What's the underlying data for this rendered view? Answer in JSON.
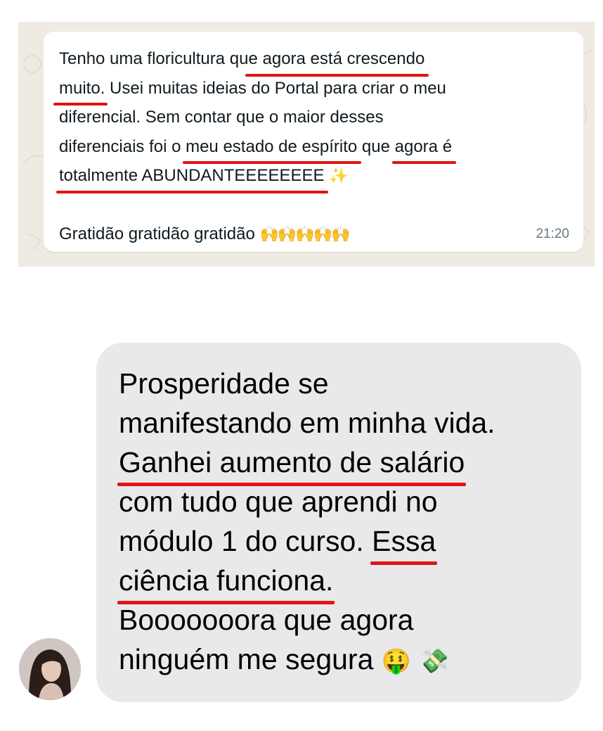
{
  "whatsapp_message": {
    "lines": [
      [
        "Tenho uma floricultura qu",
        "e agora está crescendo",
        ""
      ],
      [
        "",
        "muito.",
        " Usei muitas ideias do Portal para criar o meu"
      ],
      [
        "diferencial. Sem contar que o maior desses",
        "",
        ""
      ],
      [
        "diferenciais foi o ",
        "meu estado de espírito",
        " que "
      ],
      [
        "",
        "totalmente ABUNDANTEEEEEEEE",
        " "
      ]
    ],
    "line4_extra_underlined": "agora é",
    "line6": "Gratidão gratidão gratidão ",
    "time": "21:20",
    "icons": [
      "sparkles-icon",
      "raising-hands-icon"
    ]
  },
  "imessage": {
    "lines": [
      "Prosperidade se",
      "manifestando em minha vida.",
      "Ganhei aumento de salário",
      "com tudo que aprendi no",
      "módulo 1 do curso. ",
      "Essa",
      "ciência funciona.",
      "Booooooora que agora",
      "ninguém me segura "
    ],
    "icons": [
      "money-mouth-face-icon",
      "money-with-wings-icon"
    ]
  },
  "colors": {
    "underline": "#e11414",
    "wa_background": "#efeae2",
    "im_bubble": "#e9e9eb"
  }
}
